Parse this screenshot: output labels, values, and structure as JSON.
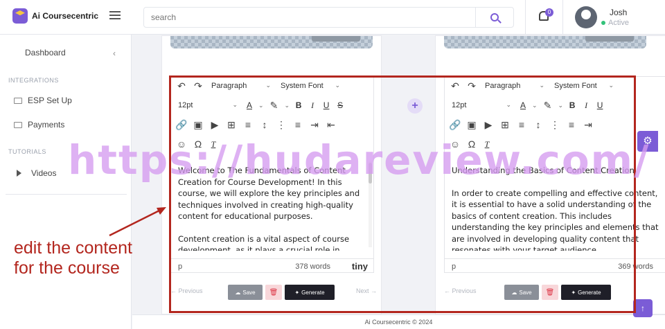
{
  "app": {
    "brand": "Ai Coursecentric",
    "footer": "Ai Coursecentric © 2024"
  },
  "header": {
    "search_placeholder": "search",
    "notifications_count": "0",
    "user": {
      "name": "Josh",
      "status": "Active"
    }
  },
  "sidebar": {
    "dashboard": "Dashboard",
    "sections": [
      {
        "title": "INTEGRATIONS",
        "items": [
          {
            "label": "ESP Set Up",
            "icon": "mail-icon"
          },
          {
            "label": "Payments",
            "icon": "card-icon"
          }
        ]
      },
      {
        "title": "TUTORIALS",
        "items": [
          {
            "label": "Videos",
            "icon": "play-icon"
          }
        ]
      }
    ]
  },
  "editor_toolbar": {
    "block_format": "Paragraph",
    "font_family": "System Font",
    "font_size": "12pt"
  },
  "cards": [
    {
      "paragraphs": [
        "Welcome to The Fundamentals of Content Creation for Course Development! In this course, we will explore the key principles and techniques involved in creating high-quality content for educational purposes.",
        "Content creation is a vital aspect of course development, as it plays a crucial role in engaging and educating learners. Through this course, you"
      ],
      "status_path": "p",
      "word_count": "378 words",
      "prev_label": "← Previous",
      "next_label": "Next →",
      "save_label": "Save",
      "generate_label": "Generate"
    },
    {
      "paragraphs": [
        "Understanding the Basics of Content Creation",
        "In order to create compelling and effective content, it is essential to have a solid understanding of the basics of content creation. This includes understanding the key principles and elements that are involved in developing quality content that resonates with your target audience."
      ],
      "status_path": "p",
      "word_count": "369 words",
      "prev_label": "← Previous",
      "save_label": "Save",
      "generate_label": "Generate"
    }
  ],
  "editor_brand": "tiny",
  "overlay": {
    "watermark": "https://hudareview.com/",
    "annotation": [
      "edit the content",
      "for the course"
    ]
  },
  "colors": {
    "accent": "#7b5cd6",
    "annotation": "#b3261e",
    "watermark": "#d69cf0"
  }
}
